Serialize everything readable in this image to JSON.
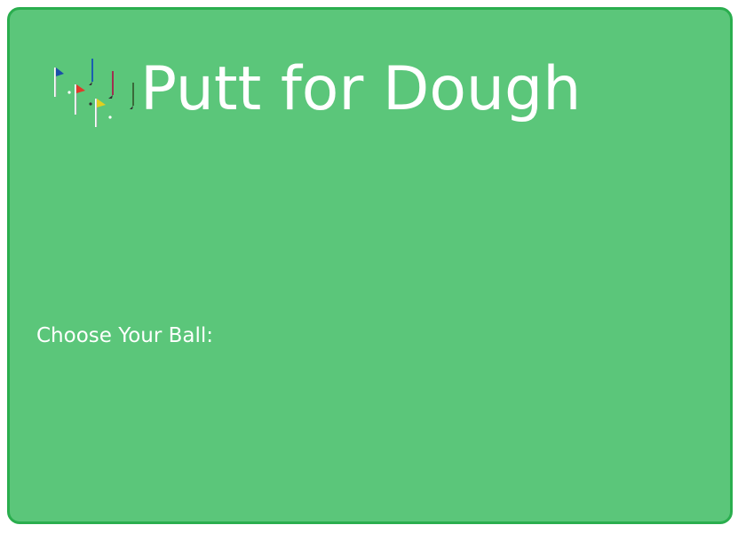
{
  "game": {
    "title": "Putt for Dough",
    "choose_ball_label": "Choose Your Ball:"
  },
  "logo": {
    "icon": "golf-flags-and-putters-icon",
    "flag_colors": [
      "#1a4fa8",
      "#e03a2a",
      "#e0d020"
    ],
    "putter_colors": [
      "#1a5fb0",
      "#a03050",
      "#3a6a3a"
    ]
  },
  "colors": {
    "panel_background": "#5bc67a",
    "panel_border": "#2aae4e",
    "text": "#ffffff"
  }
}
